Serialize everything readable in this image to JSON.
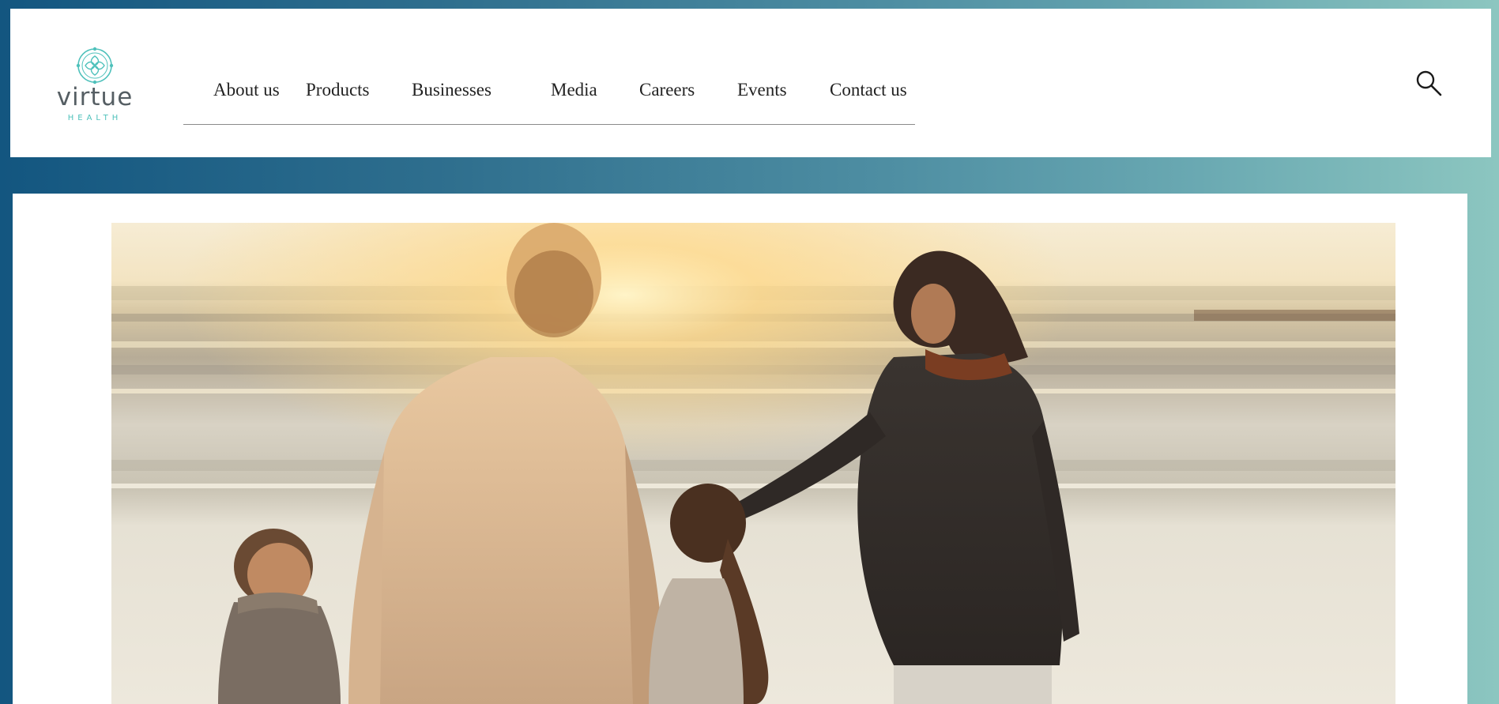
{
  "brand": {
    "name": "virtue",
    "tagline": "HEALTH",
    "accent_color": "#4fc1bb",
    "logo_icon": "floral-knot-logo-icon"
  },
  "nav": {
    "items": [
      {
        "label": "About us"
      },
      {
        "label": "Products"
      },
      {
        "label": "Businesses"
      },
      {
        "label": "Media"
      },
      {
        "label": "Careers"
      },
      {
        "label": "Events"
      },
      {
        "label": "Contact us"
      }
    ]
  },
  "search": {
    "icon": "search-icon"
  },
  "hero": {
    "image": "family-walking-on-beach-at-sunset-photo"
  },
  "colors": {
    "background_gradient_start": "#135680",
    "background_gradient_end": "#8cc6c0",
    "panel": "#ffffff",
    "nav_text": "#222222"
  }
}
